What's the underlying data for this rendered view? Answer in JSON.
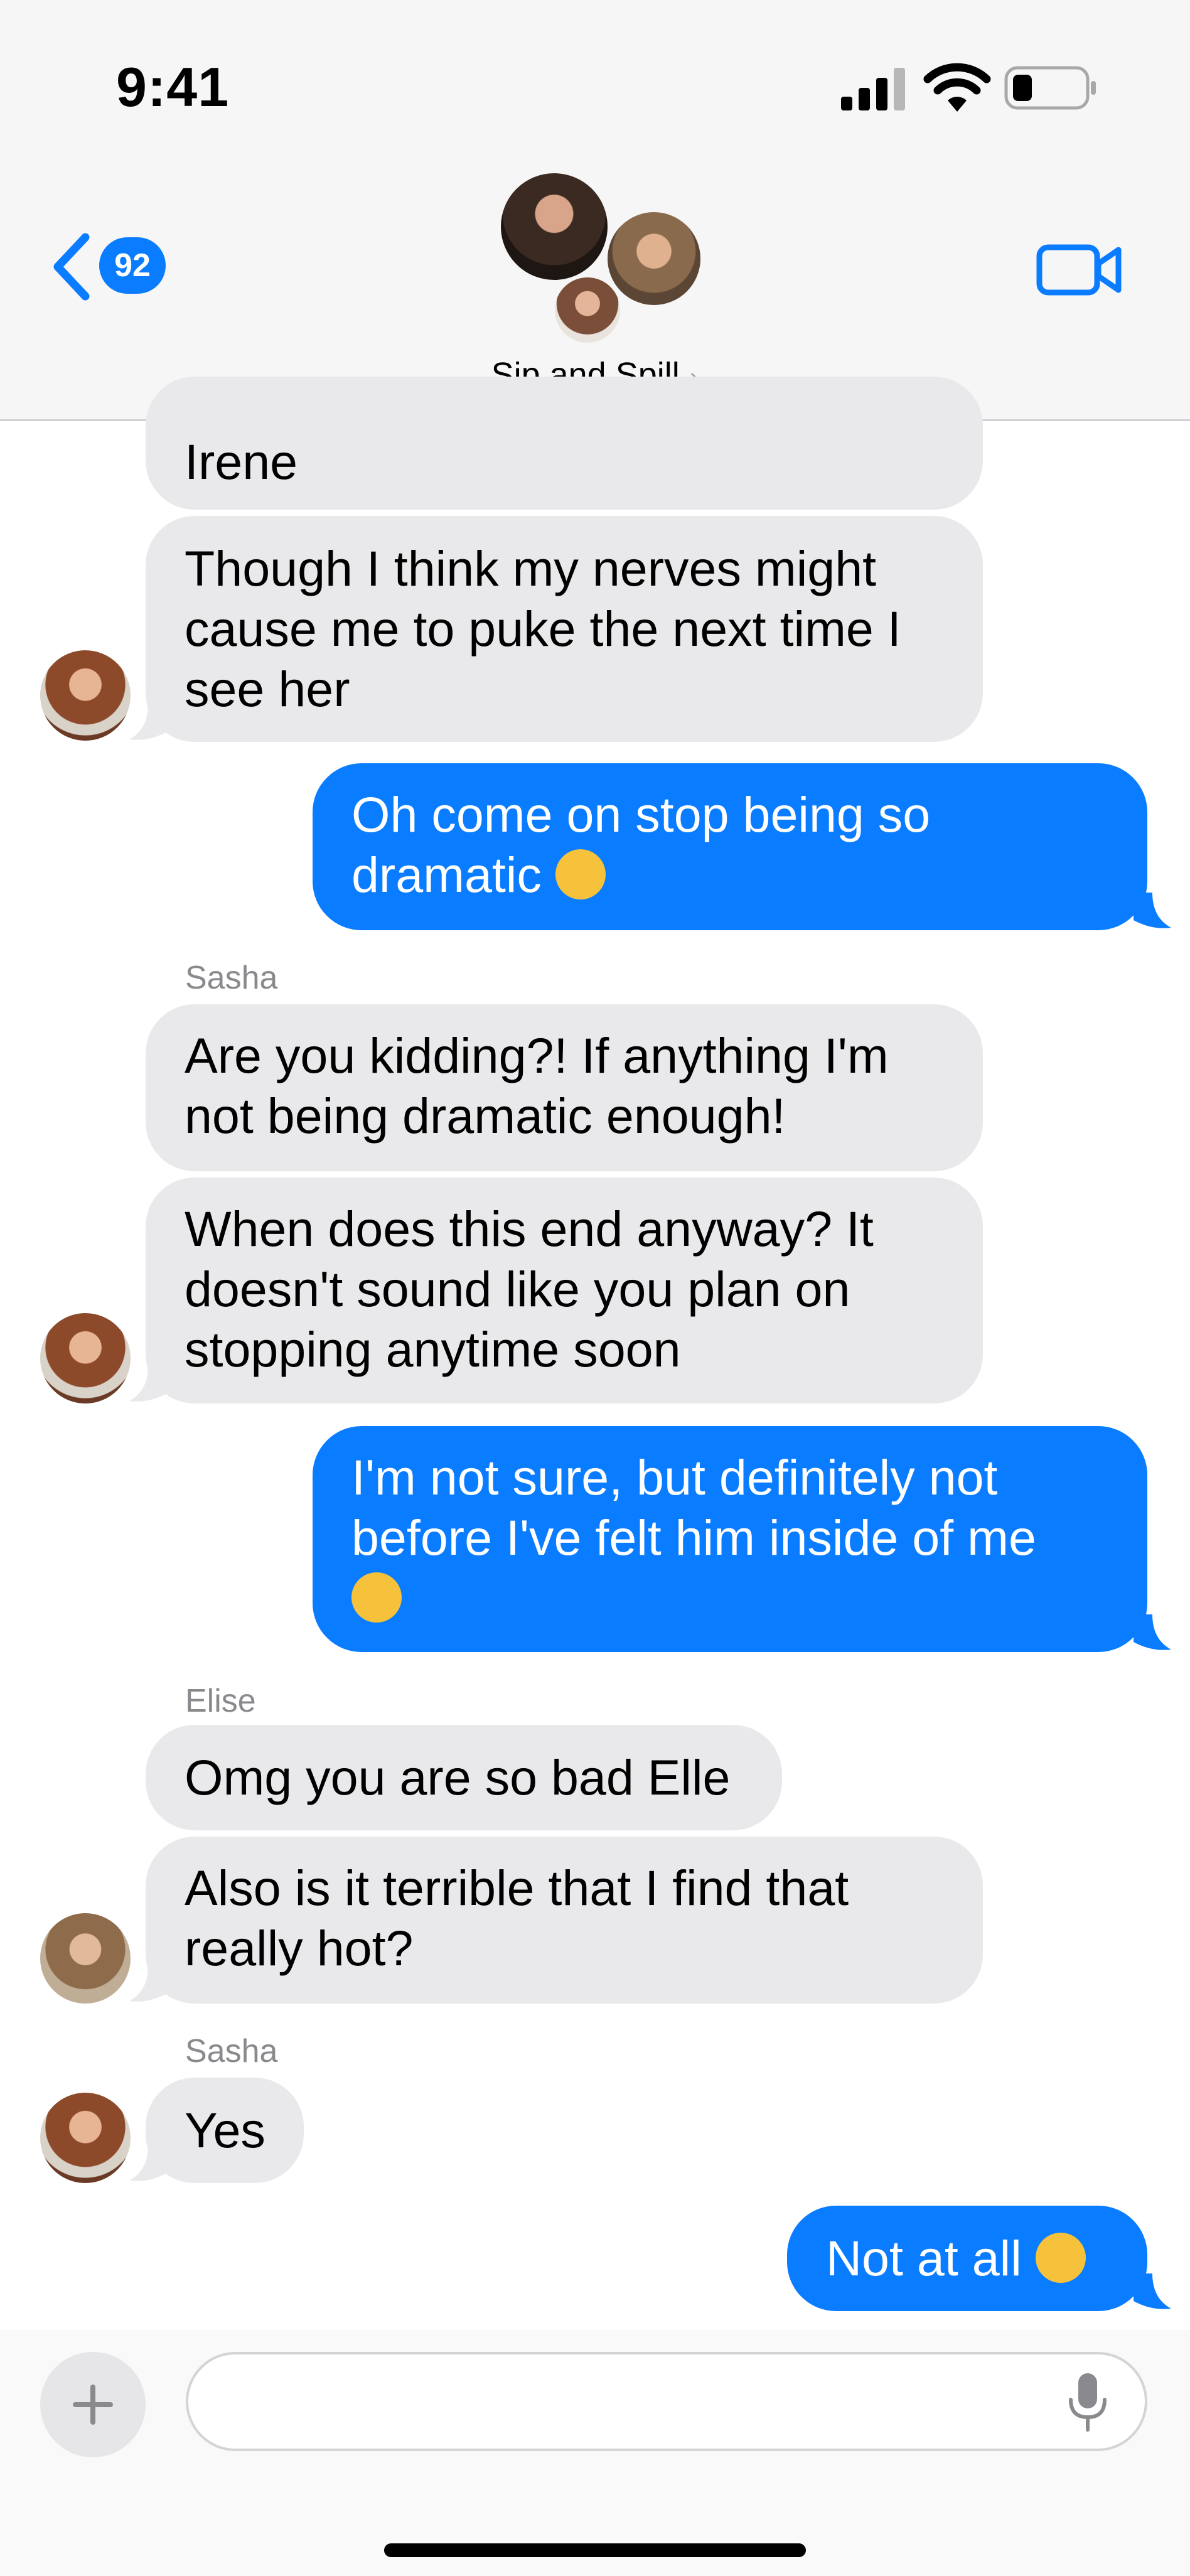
{
  "status_bar": {
    "time": "9:41"
  },
  "header": {
    "back_count": "92",
    "group_name": "Sip and Spill",
    "group_chevron": "›"
  },
  "messages": [
    {
      "direction": "in",
      "sender": "",
      "text": "Irene",
      "partial": true
    },
    {
      "direction": "in",
      "sender": "",
      "text": "Though I think my nerves might\ncause me to puke the next time I\nsee her",
      "avatar": "sasha"
    },
    {
      "direction": "out",
      "text": "Oh come on stop being so\ndramatic",
      "emoji": "joy-emoji"
    },
    {
      "direction": "in",
      "sender": "Sasha",
      "text": "Are you kidding?! If anything I'm\nnot being dramatic enough!"
    },
    {
      "direction": "in",
      "sender": "",
      "text": "When does this end anyway? It\ndoesn't sound like you plan on\nstopping anytime soon",
      "avatar": "sasha"
    },
    {
      "direction": "out",
      "text": "I'm not sure, but definitely not\nbefore I've felt him inside of me",
      "emoji": "tired-face-emoji"
    },
    {
      "direction": "in",
      "sender": "Elise",
      "text": "Omg you are so bad Elle"
    },
    {
      "direction": "in",
      "sender": "",
      "text": "Also is it terrible that I find that\nreally hot?",
      "avatar": "elise"
    },
    {
      "direction": "in",
      "sender": "Sasha",
      "text": "Yes",
      "avatar": "sasha"
    },
    {
      "direction": "out",
      "text": "Not at all",
      "emoji": "kissing-heart-emoji"
    }
  ],
  "input": {
    "placeholder": ""
  },
  "colors": {
    "accent": "#0a7cff",
    "incoming_bubble": "#e9e9eb",
    "header_bg": "#f6f6f6"
  }
}
